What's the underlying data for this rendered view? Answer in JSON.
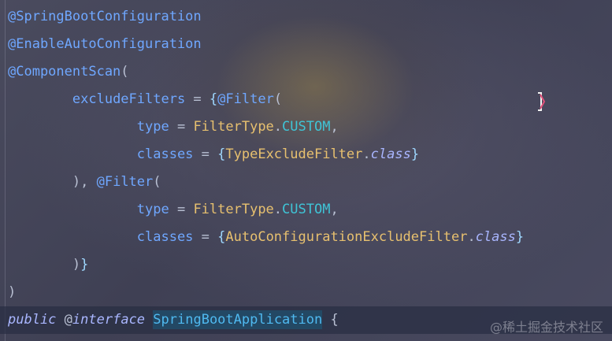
{
  "editor": {
    "lines": [
      {
        "id": "line-1",
        "tokens": [
          {
            "text": "@SpringBootConfiguration",
            "kind": "anno"
          }
        ]
      },
      {
        "id": "line-2",
        "tokens": [
          {
            "text": "@EnableAutoConfiguration",
            "kind": "anno"
          }
        ]
      },
      {
        "id": "line-3",
        "tokens": [
          {
            "text": "@ComponentScan",
            "kind": "anno"
          },
          {
            "text": "(",
            "kind": "plain"
          }
        ]
      },
      {
        "id": "line-4",
        "tokens": [
          {
            "text": "        ",
            "kind": "plain"
          },
          {
            "text": "excludeFilters",
            "kind": "field"
          },
          {
            "text": " = ",
            "kind": "plain"
          },
          {
            "text": "{",
            "kind": "brace"
          },
          {
            "text": "@Filter",
            "kind": "anno"
          },
          {
            "text": "(",
            "kind": "plain"
          }
        ]
      },
      {
        "id": "line-5",
        "tokens": [
          {
            "text": "                ",
            "kind": "plain"
          },
          {
            "text": "type",
            "kind": "field"
          },
          {
            "text": " = ",
            "kind": "plain"
          },
          {
            "text": "FilterType",
            "kind": "cls"
          },
          {
            "text": ".",
            "kind": "plain"
          },
          {
            "text": "CUSTOM",
            "kind": "const"
          },
          {
            "text": ",",
            "kind": "plain"
          }
        ]
      },
      {
        "id": "line-6",
        "tokens": [
          {
            "text": "                ",
            "kind": "plain"
          },
          {
            "text": "classes",
            "kind": "field"
          },
          {
            "text": " = ",
            "kind": "plain"
          },
          {
            "text": "{",
            "kind": "brace"
          },
          {
            "text": "TypeExcludeFilter",
            "kind": "cls"
          },
          {
            "text": ".",
            "kind": "plain"
          },
          {
            "text": "class",
            "kind": "kw"
          },
          {
            "text": "}",
            "kind": "brace"
          }
        ]
      },
      {
        "id": "line-7",
        "tokens": [
          {
            "text": "        ",
            "kind": "plain"
          },
          {
            "text": "), ",
            "kind": "plain"
          },
          {
            "text": "@Filter",
            "kind": "anno"
          },
          {
            "text": "(",
            "kind": "plain"
          }
        ]
      },
      {
        "id": "line-8",
        "tokens": [
          {
            "text": "                ",
            "kind": "plain"
          },
          {
            "text": "type",
            "kind": "field"
          },
          {
            "text": " = ",
            "kind": "plain"
          },
          {
            "text": "FilterType",
            "kind": "cls"
          },
          {
            "text": ".",
            "kind": "plain"
          },
          {
            "text": "CUSTOM",
            "kind": "const"
          },
          {
            "text": ",",
            "kind": "plain"
          }
        ]
      },
      {
        "id": "line-9",
        "tokens": [
          {
            "text": "                ",
            "kind": "plain"
          },
          {
            "text": "classes",
            "kind": "field"
          },
          {
            "text": " = ",
            "kind": "plain"
          },
          {
            "text": "{",
            "kind": "brace"
          },
          {
            "text": "AutoConfigurationExcludeFilter",
            "kind": "cls"
          },
          {
            "text": ".",
            "kind": "plain"
          },
          {
            "text": "class",
            "kind": "kw"
          },
          {
            "text": "}",
            "kind": "brace"
          }
        ]
      },
      {
        "id": "line-10",
        "tokens": [
          {
            "text": "        ",
            "kind": "plain"
          },
          {
            "text": ")",
            "kind": "plain"
          },
          {
            "text": "}",
            "kind": "brace"
          }
        ]
      },
      {
        "id": "line-11",
        "tokens": [
          {
            "text": ")",
            "kind": "plain"
          }
        ]
      },
      {
        "id": "line-12",
        "current": true,
        "tokens": [
          {
            "text": "public",
            "kind": "kw"
          },
          {
            "text": " ",
            "kind": "plain"
          },
          {
            "text": "@",
            "kind": "plain"
          },
          {
            "text": "interface",
            "kind": "kw"
          },
          {
            "text": " ",
            "kind": "plain"
          },
          {
            "text": "SpringBootApplication",
            "kind": "decl"
          },
          {
            "text": " {",
            "kind": "plain"
          }
        ]
      }
    ]
  },
  "watermark": {
    "text": "@稀土掘金技术社区"
  },
  "colors": {
    "annotation": "#6fa7ff",
    "class_name": "#e7c06f",
    "constant": "#3fc4d6",
    "keyword": "#a9b6ff",
    "brace": "#9fd8ff"
  },
  "icons": {
    "cursor": "text-cursor-icon"
  }
}
